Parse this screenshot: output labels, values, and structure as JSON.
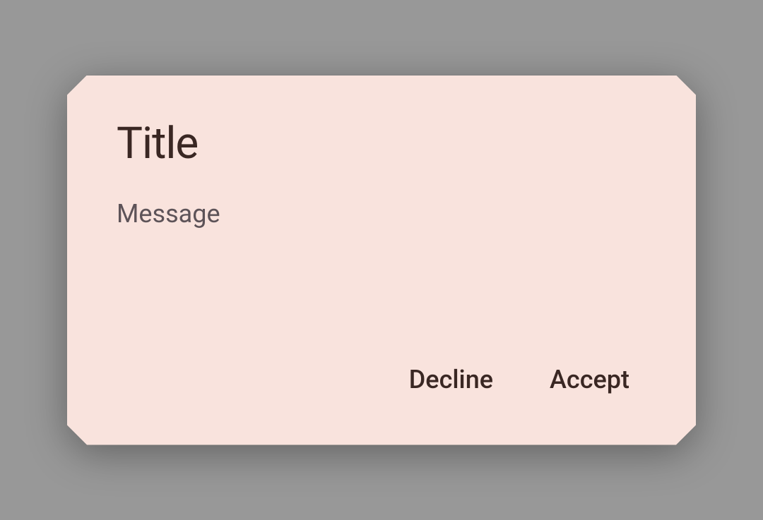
{
  "dialog": {
    "title": "Title",
    "message": "Message",
    "actions": {
      "decline_label": "Decline",
      "accept_label": "Accept"
    }
  }
}
